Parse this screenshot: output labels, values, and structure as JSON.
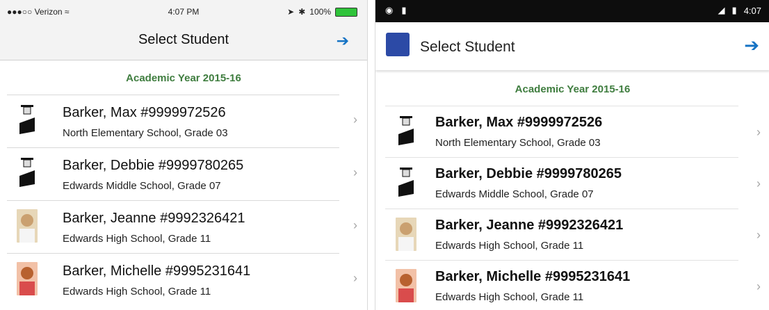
{
  "ios": {
    "status": {
      "carrier": "●●●○○ Verizon ≈",
      "time": "4:07 PM",
      "battery_pct": "100%"
    },
    "nav": {
      "title": "Select Student"
    },
    "year": "Academic Year 2015-16",
    "students": [
      {
        "name": "Barker, Max #9999972526",
        "school": "North Elementary School, Grade 03"
      },
      {
        "name": "Barker, Debbie #9999780265",
        "school": "Edwards Middle School, Grade 07"
      },
      {
        "name": "Barker, Jeanne #9992326421",
        "school": "Edwards High School, Grade 11"
      },
      {
        "name": "Barker, Michelle #9995231641",
        "school": "Edwards High School, Grade 11"
      }
    ]
  },
  "android": {
    "status": {
      "time": "4:07"
    },
    "nav": {
      "title": "Select Student"
    },
    "year": "Academic Year 2015-16",
    "students": [
      {
        "name": "Barker, Max #9999972526",
        "school": "North Elementary School, Grade 03"
      },
      {
        "name": "Barker, Debbie #9999780265",
        "school": "Edwards Middle School, Grade 07"
      },
      {
        "name": "Barker, Jeanne #9992326421",
        "school": "Edwards High School, Grade 11"
      },
      {
        "name": "Barker, Michelle #9995231641",
        "school": "Edwards High School, Grade 11"
      }
    ]
  },
  "colors": {
    "accent": "#1573c4",
    "year_green": "#3f7d3f",
    "android_logo": "#2c4aa6"
  },
  "icons": {
    "logout": "logout-arrow-icon",
    "chevron": "chevron-right-icon",
    "avatar": "graduate-avatar-icon"
  }
}
